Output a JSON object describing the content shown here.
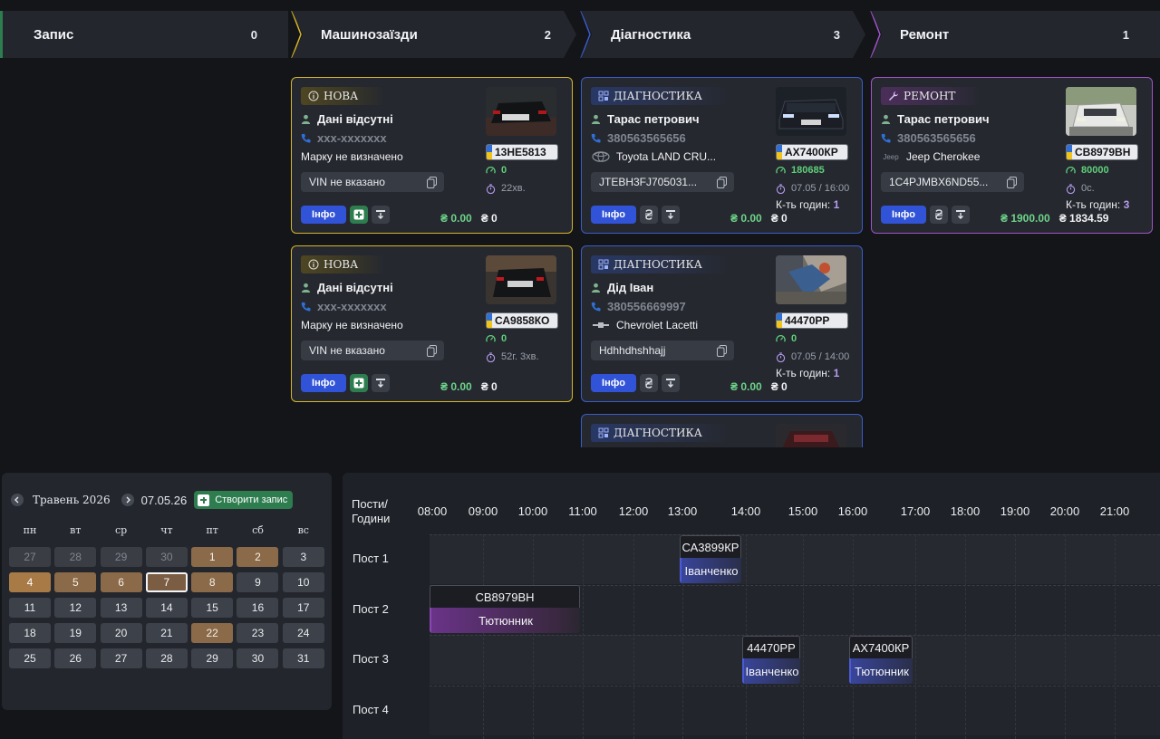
{
  "stages": [
    {
      "title": "Запис",
      "count": "0"
    },
    {
      "title": "Машинозаїзди",
      "count": "2"
    },
    {
      "title": "Діагностика",
      "count": "3"
    },
    {
      "title": "Ремонт",
      "count": "1"
    }
  ],
  "colors": {
    "yellow": "#d6b52a",
    "blue": "#3c5cc9",
    "purple": "#a055c9",
    "green": "#2e7d4f",
    "info_button": "#3153d8"
  },
  "cards": [
    {
      "status": "НОВА",
      "name": "Дані відсутні",
      "phone": "xxx-xxxxxxx",
      "brand": "Марку не визначено",
      "vin": "VIN не вказано",
      "plate": "13НЕ5813",
      "mileage": "0",
      "time": "22хв.",
      "hours_label": "",
      "hours_value": "",
      "info_label": "Інфо",
      "amount1": "₴ 0.00",
      "amount2": "₴ 0"
    },
    {
      "status": "НОВА",
      "name": "Дані відсутні",
      "phone": "xxx-xxxxxxx",
      "brand": "Марку не визначено",
      "vin": "VIN не вказано",
      "plate": "СА9858КО",
      "mileage": "0",
      "time": "52г. 3хв.",
      "hours_label": "",
      "hours_value": "",
      "info_label": "Інфо",
      "amount1": "₴ 0.00",
      "amount2": "₴ 0"
    },
    {
      "status": "ДІАГНОСТИКА",
      "name": "Тарас петрович",
      "phone": "380563565656",
      "brand": "Toyota LAND CRU...",
      "vin": "JTEBH3FJ705031...",
      "plate": "АХ7400КР",
      "mileage": "180685",
      "time": "07.05 / 16:00",
      "hours_label": "К-ть годин: ",
      "hours_value": "1",
      "info_label": "Інфо",
      "amount1": "₴ 0.00",
      "amount2": "₴ 0"
    },
    {
      "status": "ДІАГНОСТИКА",
      "name": "Дід Іван",
      "phone": "380556669997",
      "brand": "Chevrolet Lacetti",
      "vin": "Hdhhdhshhajj",
      "plate": "44470РР",
      "mileage": "0",
      "time": "07.05 / 14:00",
      "hours_label": "К-ть годин: ",
      "hours_value": "1",
      "info_label": "Інфо",
      "amount1": "₴ 0.00",
      "amount2": "₴ 0"
    },
    {
      "status": "ДІАГНОСТИКА"
    },
    {
      "status": "РЕМОНТ",
      "name": "Тарас петрович",
      "phone": "380563565656",
      "brand_logo": "Jeep",
      "brand": "Jeep Cherokee",
      "vin": "1C4PJMBX6ND55...",
      "plate": "СВ8979ВН",
      "mileage": "80000",
      "time": "0с.",
      "hours_label": "К-ть годин: ",
      "hours_value": "3",
      "info_label": "Інфо",
      "amount1": "₴ 1900.00",
      "amount2": "₴ 1834.59"
    }
  ],
  "calendar": {
    "month": "Травень 2026",
    "date": "07.05.26",
    "create_label": "Створити запис",
    "weekdays": [
      "пн",
      "вт",
      "ср",
      "чт",
      "пт",
      "сб",
      "вс"
    ],
    "days": [
      "27",
      "28",
      "29",
      "30",
      "1",
      "2",
      "3",
      "4",
      "5",
      "6",
      "7",
      "8",
      "9",
      "10",
      "11",
      "12",
      "13",
      "14",
      "15",
      "16",
      "17",
      "18",
      "19",
      "20",
      "21",
      "22",
      "23",
      "24",
      "25",
      "26",
      "27",
      "28",
      "29",
      "30",
      "31"
    ]
  },
  "schedule": {
    "corner_line1": "Пости/",
    "corner_line2": "Години",
    "hours": [
      "08:00",
      "09:00",
      "10:00",
      "11:00",
      "12:00",
      "13:00",
      "14:00",
      "15:00",
      "16:00",
      "17:00",
      "18:00",
      "19:00",
      "20:00",
      "21:00"
    ],
    "posts": [
      "Пост 1",
      "Пост 2",
      "Пост 3",
      "Пост 4"
    ],
    "bookings": [
      {
        "plate": "СА3899КР",
        "name": "Іванченко"
      },
      {
        "plate": "СВ8979ВН",
        "name": "Тютюнник"
      },
      {
        "plate": "44470РР",
        "name": "Іванченко"
      },
      {
        "plate": "АХ7400КР",
        "name": "Тютюнник"
      }
    ]
  }
}
